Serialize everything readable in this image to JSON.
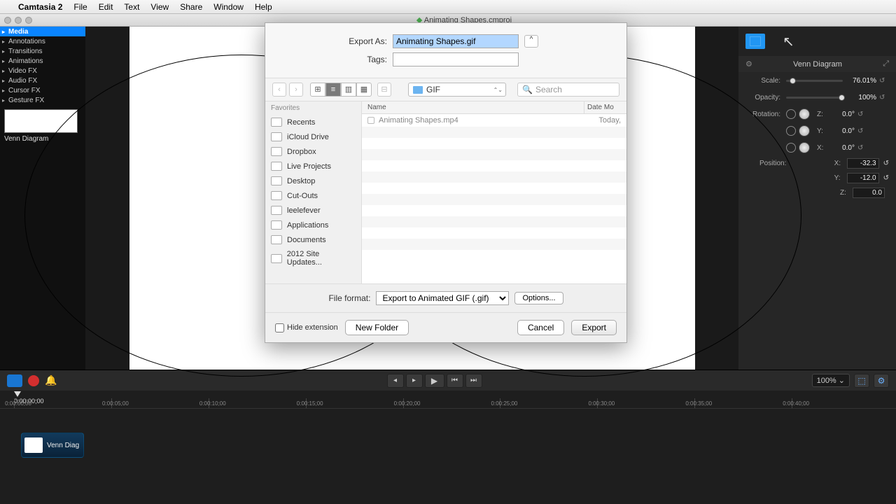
{
  "menubar": {
    "app": "Camtasia 2",
    "items": [
      "File",
      "Edit",
      "Text",
      "View",
      "Share",
      "Window",
      "Help"
    ]
  },
  "window_title": "Animating Shapes.cmproj",
  "left_tabs": [
    "Media",
    "Annotations",
    "Transitions",
    "Animations",
    "Video FX",
    "Audio FX",
    "Cursor FX",
    "Gesture FX"
  ],
  "media_item_label": "Venn Diagram",
  "props": {
    "title": "Venn Diagram",
    "scale": {
      "label": "Scale:",
      "value": "76.01%"
    },
    "opacity": {
      "label": "Opacity:",
      "value": "100%"
    },
    "rotation_label": "Rotation:",
    "rot_z": {
      "axis": "Z:",
      "value": "0.0°"
    },
    "rot_y": {
      "axis": "Y:",
      "value": "0.0°"
    },
    "rot_x": {
      "axis": "X:",
      "value": "0.0°"
    },
    "position_label": "Position:",
    "pos_x": {
      "axis": "X:",
      "value": "-32.3"
    },
    "pos_y": {
      "axis": "Y:",
      "value": "-12.0"
    },
    "pos_z": {
      "axis": "Z:",
      "value": "0.0"
    }
  },
  "dialog": {
    "export_as_label": "Export As:",
    "export_as_value": "Animating Shapes.gif",
    "tags_label": "Tags:",
    "folder": "GIF",
    "search_placeholder": "Search",
    "favorites_label": "Favorites",
    "favorites": [
      "Recents",
      "iCloud Drive",
      "Dropbox",
      "Live Projects",
      "Desktop",
      "Cut-Outs",
      "leelefever",
      "Applications",
      "Documents",
      "2012 Site Updates..."
    ],
    "col_name": "Name",
    "col_date": "Date Mo",
    "file_name": "Animating Shapes.mp4",
    "file_date": "Today,",
    "format_label": "File format:",
    "format_value": "Export to Animated GIF (.gif)",
    "options_btn": "Options...",
    "hide_ext": "Hide extension",
    "new_folder": "New Folder",
    "cancel": "Cancel",
    "export": "Export"
  },
  "playbar": {
    "zoom": "100%"
  },
  "timeline": {
    "playhead": "0:00:00;00",
    "ticks": [
      "0:00:00;00",
      "0:00:05;00",
      "0:00:10;00",
      "0:00:15;00",
      "0:00:20;00",
      "0:00:25;00",
      "0:00:30;00",
      "0:00:35;00",
      "0:00:40;00"
    ],
    "clip_name": "Venn Diag"
  }
}
